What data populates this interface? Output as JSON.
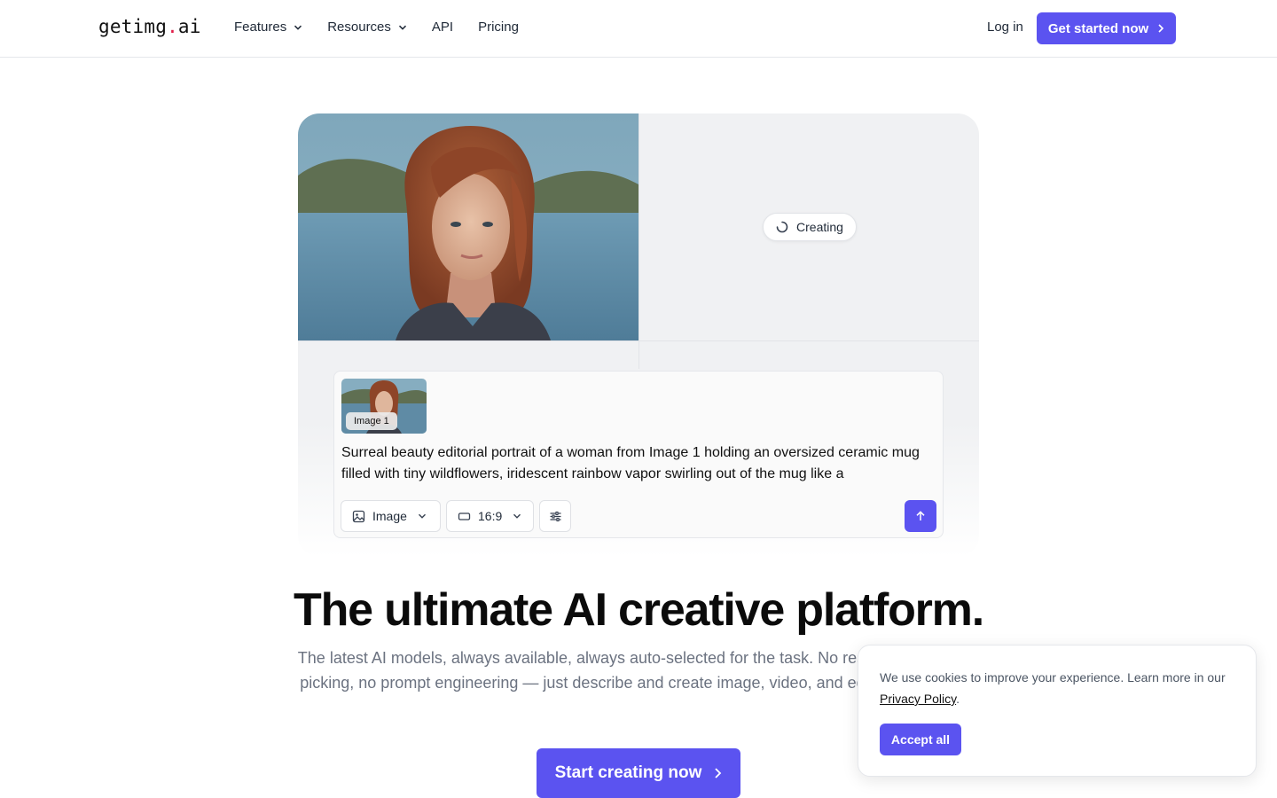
{
  "nav": {
    "logo_pre": "getimg",
    "logo_dot": ".",
    "logo_post": "ai",
    "links": [
      "Features",
      "Resources",
      "API",
      "Pricing"
    ],
    "login": "Log in",
    "cta": "Get started now"
  },
  "hero": {
    "status": "Creating",
    "prompt": {
      "image_tag": "Image 1",
      "text": "Surreal beauty editorial portrait of a woman from Image 1 holding an oversized ceramic mug filled with tiny wildflowers, iridescent rainbow vapor swirling out of the mug like a",
      "mode": "Image",
      "aspect": "16:9"
    }
  },
  "main": {
    "headline": "The ultimate AI creative platform.",
    "subtext": "The latest AI models, always available, always auto-selected for the task. No research, no model picking, no prompt engineering — just describe and create image, video, and editing in one tool.",
    "cta": "Start creating now"
  },
  "cookie": {
    "text": "We use cookies to improve your experience. Learn more in our ",
    "link": "Privacy Policy",
    "after": ".",
    "accept": "Accept all"
  },
  "colors": {
    "accent": "#5b53f0",
    "logo_dot": "#e11d48"
  },
  "icons": [
    "chevron-down-icon",
    "chevron-right-icon",
    "spinner-icon",
    "image-icon",
    "aspect-ratio-icon",
    "sliders-icon",
    "arrow-up-icon"
  ]
}
